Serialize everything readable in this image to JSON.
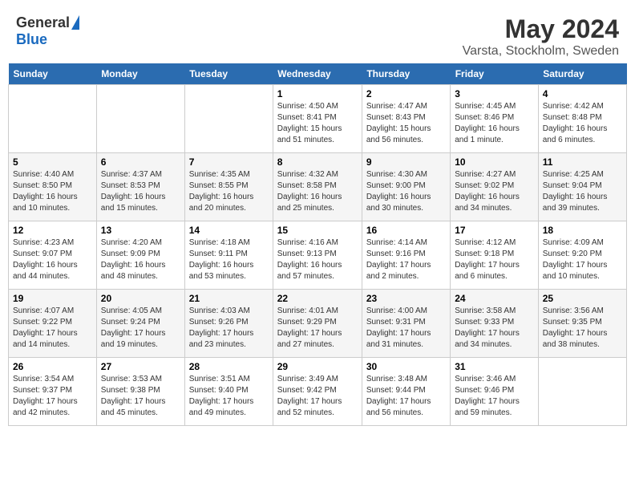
{
  "header": {
    "logo_general": "General",
    "logo_blue": "Blue",
    "month": "May 2024",
    "location": "Varsta, Stockholm, Sweden"
  },
  "weekdays": [
    "Sunday",
    "Monday",
    "Tuesday",
    "Wednesday",
    "Thursday",
    "Friday",
    "Saturday"
  ],
  "weeks": [
    [
      {
        "day": "",
        "info": ""
      },
      {
        "day": "",
        "info": ""
      },
      {
        "day": "",
        "info": ""
      },
      {
        "day": "1",
        "info": "Sunrise: 4:50 AM\nSunset: 8:41 PM\nDaylight: 15 hours\nand 51 minutes."
      },
      {
        "day": "2",
        "info": "Sunrise: 4:47 AM\nSunset: 8:43 PM\nDaylight: 15 hours\nand 56 minutes."
      },
      {
        "day": "3",
        "info": "Sunrise: 4:45 AM\nSunset: 8:46 PM\nDaylight: 16 hours\nand 1 minute."
      },
      {
        "day": "4",
        "info": "Sunrise: 4:42 AM\nSunset: 8:48 PM\nDaylight: 16 hours\nand 6 minutes."
      }
    ],
    [
      {
        "day": "5",
        "info": "Sunrise: 4:40 AM\nSunset: 8:50 PM\nDaylight: 16 hours\nand 10 minutes."
      },
      {
        "day": "6",
        "info": "Sunrise: 4:37 AM\nSunset: 8:53 PM\nDaylight: 16 hours\nand 15 minutes."
      },
      {
        "day": "7",
        "info": "Sunrise: 4:35 AM\nSunset: 8:55 PM\nDaylight: 16 hours\nand 20 minutes."
      },
      {
        "day": "8",
        "info": "Sunrise: 4:32 AM\nSunset: 8:58 PM\nDaylight: 16 hours\nand 25 minutes."
      },
      {
        "day": "9",
        "info": "Sunrise: 4:30 AM\nSunset: 9:00 PM\nDaylight: 16 hours\nand 30 minutes."
      },
      {
        "day": "10",
        "info": "Sunrise: 4:27 AM\nSunset: 9:02 PM\nDaylight: 16 hours\nand 34 minutes."
      },
      {
        "day": "11",
        "info": "Sunrise: 4:25 AM\nSunset: 9:04 PM\nDaylight: 16 hours\nand 39 minutes."
      }
    ],
    [
      {
        "day": "12",
        "info": "Sunrise: 4:23 AM\nSunset: 9:07 PM\nDaylight: 16 hours\nand 44 minutes."
      },
      {
        "day": "13",
        "info": "Sunrise: 4:20 AM\nSunset: 9:09 PM\nDaylight: 16 hours\nand 48 minutes."
      },
      {
        "day": "14",
        "info": "Sunrise: 4:18 AM\nSunset: 9:11 PM\nDaylight: 16 hours\nand 53 minutes."
      },
      {
        "day": "15",
        "info": "Sunrise: 4:16 AM\nSunset: 9:13 PM\nDaylight: 16 hours\nand 57 minutes."
      },
      {
        "day": "16",
        "info": "Sunrise: 4:14 AM\nSunset: 9:16 PM\nDaylight: 17 hours\nand 2 minutes."
      },
      {
        "day": "17",
        "info": "Sunrise: 4:12 AM\nSunset: 9:18 PM\nDaylight: 17 hours\nand 6 minutes."
      },
      {
        "day": "18",
        "info": "Sunrise: 4:09 AM\nSunset: 9:20 PM\nDaylight: 17 hours\nand 10 minutes."
      }
    ],
    [
      {
        "day": "19",
        "info": "Sunrise: 4:07 AM\nSunset: 9:22 PM\nDaylight: 17 hours\nand 14 minutes."
      },
      {
        "day": "20",
        "info": "Sunrise: 4:05 AM\nSunset: 9:24 PM\nDaylight: 17 hours\nand 19 minutes."
      },
      {
        "day": "21",
        "info": "Sunrise: 4:03 AM\nSunset: 9:26 PM\nDaylight: 17 hours\nand 23 minutes."
      },
      {
        "day": "22",
        "info": "Sunrise: 4:01 AM\nSunset: 9:29 PM\nDaylight: 17 hours\nand 27 minutes."
      },
      {
        "day": "23",
        "info": "Sunrise: 4:00 AM\nSunset: 9:31 PM\nDaylight: 17 hours\nand 31 minutes."
      },
      {
        "day": "24",
        "info": "Sunrise: 3:58 AM\nSunset: 9:33 PM\nDaylight: 17 hours\nand 34 minutes."
      },
      {
        "day": "25",
        "info": "Sunrise: 3:56 AM\nSunset: 9:35 PM\nDaylight: 17 hours\nand 38 minutes."
      }
    ],
    [
      {
        "day": "26",
        "info": "Sunrise: 3:54 AM\nSunset: 9:37 PM\nDaylight: 17 hours\nand 42 minutes."
      },
      {
        "day": "27",
        "info": "Sunrise: 3:53 AM\nSunset: 9:38 PM\nDaylight: 17 hours\nand 45 minutes."
      },
      {
        "day": "28",
        "info": "Sunrise: 3:51 AM\nSunset: 9:40 PM\nDaylight: 17 hours\nand 49 minutes."
      },
      {
        "day": "29",
        "info": "Sunrise: 3:49 AM\nSunset: 9:42 PM\nDaylight: 17 hours\nand 52 minutes."
      },
      {
        "day": "30",
        "info": "Sunrise: 3:48 AM\nSunset: 9:44 PM\nDaylight: 17 hours\nand 56 minutes."
      },
      {
        "day": "31",
        "info": "Sunrise: 3:46 AM\nSunset: 9:46 PM\nDaylight: 17 hours\nand 59 minutes."
      },
      {
        "day": "",
        "info": ""
      }
    ]
  ]
}
